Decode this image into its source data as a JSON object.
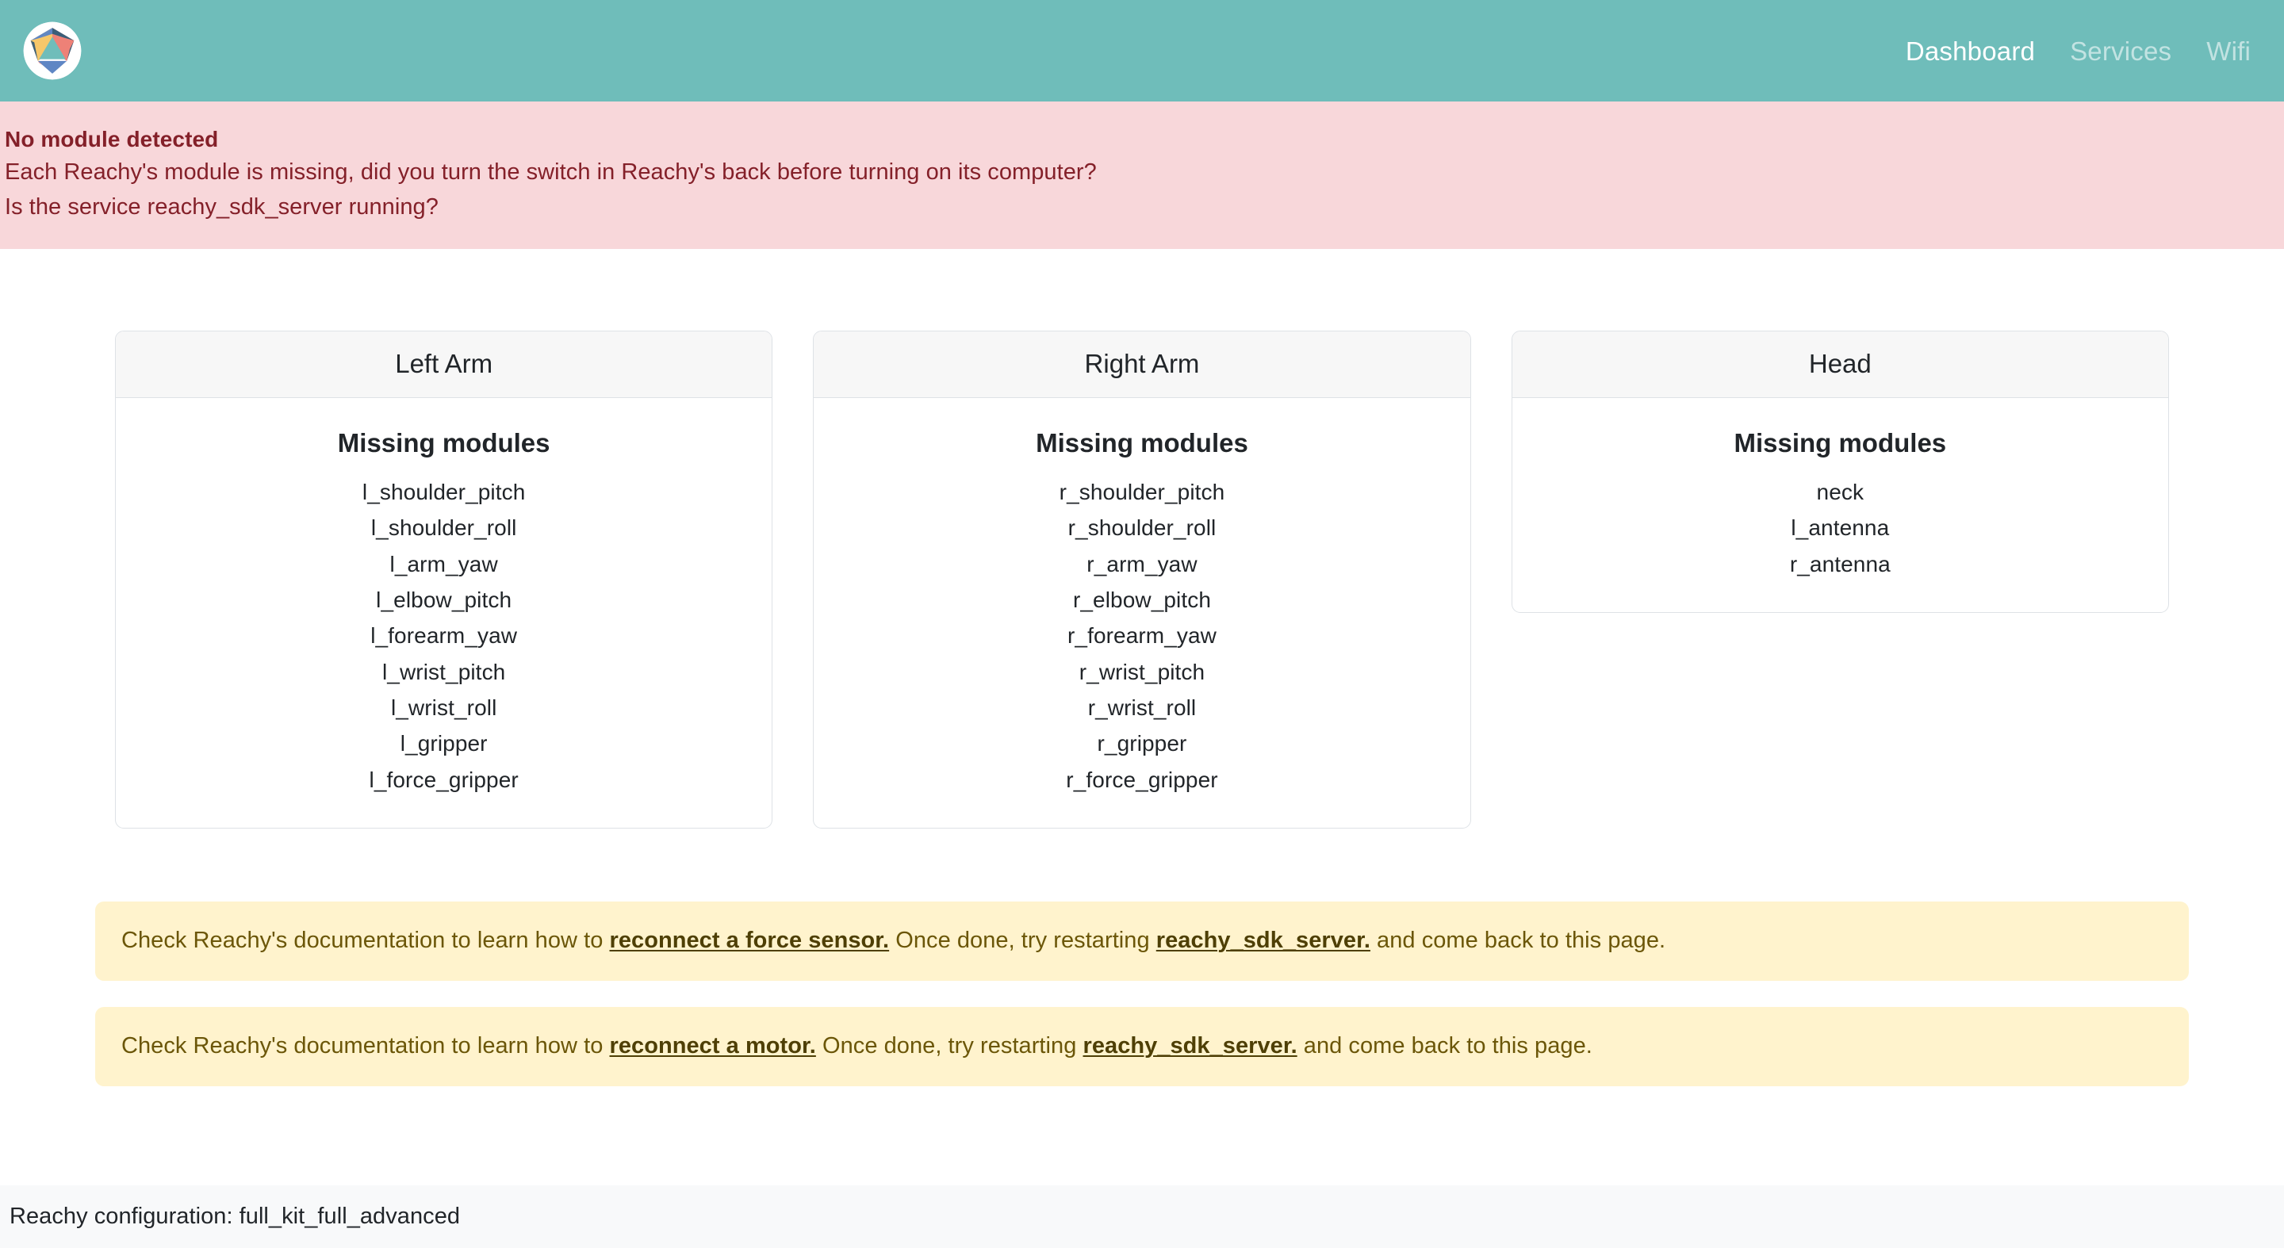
{
  "navbar": {
    "logo_alt": "reachy-logo",
    "links": [
      {
        "label": "Dashboard",
        "active": true
      },
      {
        "label": "Services",
        "active": false
      },
      {
        "label": "Wifi",
        "active": false
      }
    ]
  },
  "danger_alert": {
    "title": "No module detected",
    "line1": "Each Reachy's module is missing, did you turn the switch in Reachy's back before turning on its computer?",
    "line2": "Is the service reachy_sdk_server running?"
  },
  "cards": [
    {
      "title": "Left Arm",
      "section_title": "Missing modules",
      "modules": [
        "l_shoulder_pitch",
        "l_shoulder_roll",
        "l_arm_yaw",
        "l_elbow_pitch",
        "l_forearm_yaw",
        "l_wrist_pitch",
        "l_wrist_roll",
        "l_gripper",
        "l_force_gripper"
      ]
    },
    {
      "title": "Right Arm",
      "section_title": "Missing modules",
      "modules": [
        "r_shoulder_pitch",
        "r_shoulder_roll",
        "r_arm_yaw",
        "r_elbow_pitch",
        "r_forearm_yaw",
        "r_wrist_pitch",
        "r_wrist_roll",
        "r_gripper",
        "r_force_gripper"
      ]
    },
    {
      "title": "Head",
      "section_title": "Missing modules",
      "modules": [
        "neck",
        "l_antenna",
        "r_antenna"
      ]
    }
  ],
  "warnings": [
    {
      "text_before": "Check Reachy's documentation to learn how to ",
      "link1": "reconnect a force sensor.",
      "text_middle": " Once done, try restarting ",
      "link2": "reachy_sdk_server.",
      "text_after": " and come back to this page."
    },
    {
      "text_before": "Check Reachy's documentation to learn how to ",
      "link1": "reconnect a motor.",
      "text_middle": " Once done, try restarting ",
      "link2": "reachy_sdk_server.",
      "text_after": " and come back to this page."
    }
  ],
  "footer": {
    "text": "Reachy configuration: full_kit_full_advanced"
  },
  "colors": {
    "navbar_bg": "#6FBDBA",
    "danger_bg": "#F8D7DA",
    "danger_text": "#842029",
    "warning_bg": "#FFF3CD",
    "warning_text": "#6b5608",
    "card_header_bg": "#F7F7F7",
    "card_border": "#DEE2E6",
    "footer_bg": "#F8F9FA"
  }
}
